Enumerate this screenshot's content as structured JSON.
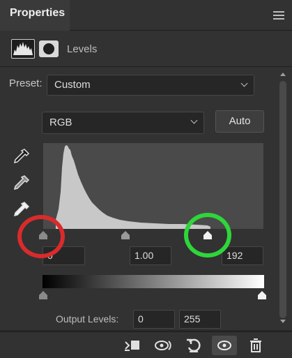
{
  "panel": {
    "title": "Properties"
  },
  "header": {
    "label": "Levels"
  },
  "preset": {
    "label": "Preset:",
    "value": "Custom"
  },
  "channel": {
    "value": "RGB"
  },
  "buttons": {
    "auto": "Auto"
  },
  "input_levels": {
    "black": "0",
    "gamma": "1.00",
    "white": "192"
  },
  "output_levels": {
    "label": "Output Levels:",
    "black": "0",
    "white": "255"
  },
  "icons": {
    "panel_menu": "hamburger-menu-icon",
    "adjustment": "levels-histogram-icon",
    "mask": "layer-mask-icon",
    "eyedroppers": [
      "black-point-eyedropper-icon",
      "gray-point-eyedropper-icon",
      "white-point-eyedropper-icon"
    ],
    "footer": [
      "clip-to-layer-icon",
      "view-previous-state-icon",
      "reset-icon",
      "toggle-visibility-icon",
      "delete-icon"
    ]
  },
  "colors": {
    "annotation_red": "#d92b2b",
    "annotation_green": "#2ed63a",
    "histogram_fill": "#c8c8c8"
  }
}
